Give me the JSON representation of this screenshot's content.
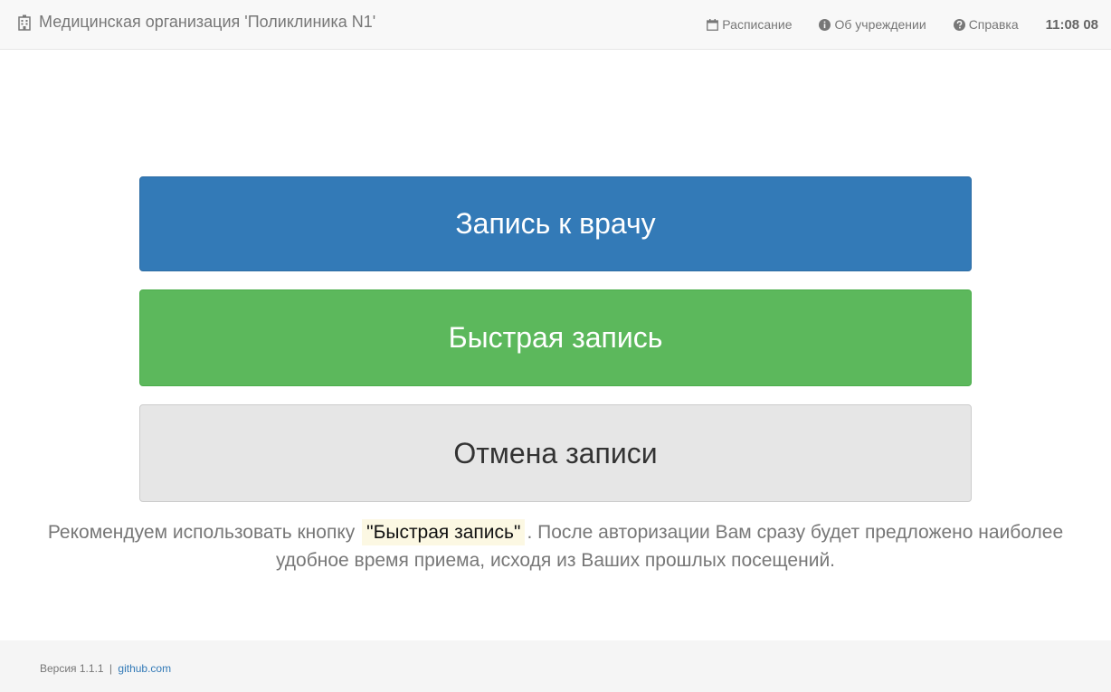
{
  "navbar": {
    "brand_label": "Медицинская организация 'Поликлиника N1'",
    "links": [
      {
        "icon": "calendar-icon",
        "label": "Расписание"
      },
      {
        "icon": "info-circle-icon",
        "label": "Об учреждении"
      },
      {
        "icon": "question-circle-icon",
        "label": "Справка"
      }
    ],
    "clock": "11:08 08"
  },
  "main": {
    "buttons": [
      {
        "label": "Запись к врачу",
        "color": "#337ab7"
      },
      {
        "label": "Быстрая запись",
        "color": "#5cb85c"
      },
      {
        "label": "Отмена записи",
        "color": "#e6e6e6"
      }
    ],
    "hint": {
      "before": "Рекомендуем использовать кнопку",
      "highlight": "\"Быстрая запись\"",
      "after": ". После авторизации Вам сразу будет предложено наиболее удобное время приема, исходя из Ваших прошлых посещений."
    }
  },
  "footer": {
    "version_label": "Версия 1.1.1",
    "separator": "|",
    "link_label": "github.com"
  }
}
